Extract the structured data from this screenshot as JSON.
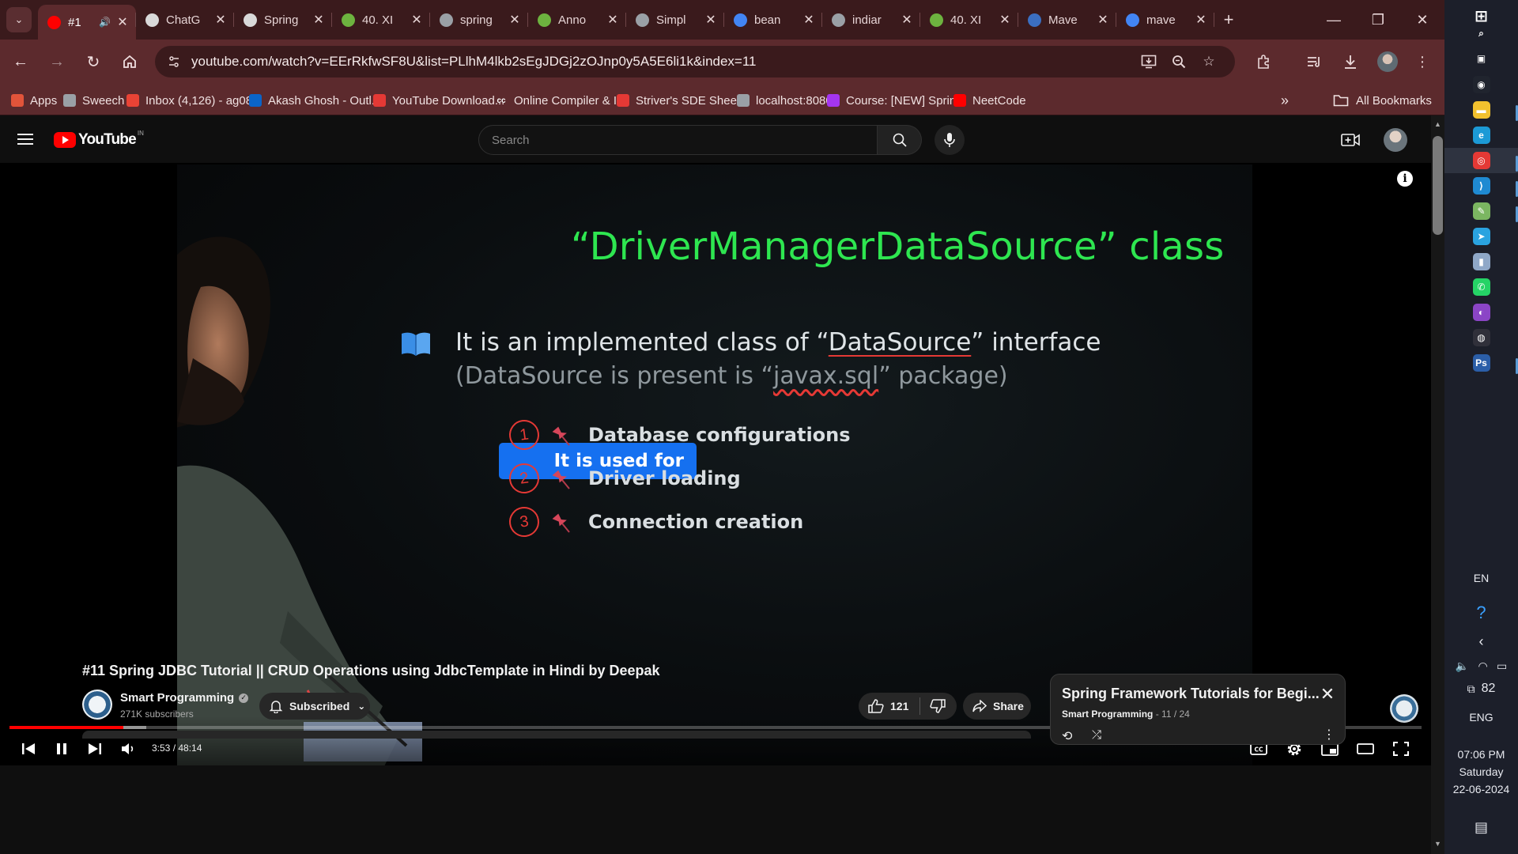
{
  "browser": {
    "tabs": [
      {
        "title": "#1",
        "fav": "youtube",
        "color": "#ff0000",
        "active": true
      },
      {
        "title": "ChatG",
        "fav": "chatgpt",
        "color": "#d9d9d9"
      },
      {
        "title": "Spring",
        "fav": "chatgpt",
        "color": "#d9d9d9"
      },
      {
        "title": "40. XI",
        "fav": "spring-leaf",
        "color": "#6db33f"
      },
      {
        "title": "spring",
        "fav": "globe",
        "color": "#9aa0a6"
      },
      {
        "title": "Anno",
        "fav": "spring-leaf",
        "color": "#6db33f"
      },
      {
        "title": "Simpl",
        "fav": "globe",
        "color": "#9aa0a6"
      },
      {
        "title": "bean",
        "fav": "google",
        "color": "#4285f4"
      },
      {
        "title": "indiar",
        "fav": "globe",
        "color": "#9aa0a6"
      },
      {
        "title": "40. XI",
        "fav": "spring-leaf",
        "color": "#6db33f"
      },
      {
        "title": "Mave",
        "fav": "maven",
        "color": "#3b6fc1"
      },
      {
        "title": "mave",
        "fav": "google",
        "color": "#4285f4"
      }
    ],
    "url": "youtube.com/watch?v=EErRkfwSF8U&list=PLlhM4lkb2sEgJDGj2zOJnp0y5A5E6li1k&index=11",
    "bookmarks": [
      {
        "label": "Apps",
        "icon": "apps-grid",
        "color": "#e2543a"
      },
      {
        "label": "Sweech",
        "icon": "globe",
        "color": "#9aa0a6"
      },
      {
        "label": "Inbox (4,126) - ag08...",
        "icon": "gmail",
        "color": "#ea4335"
      },
      {
        "label": "Akash Ghosh - Outl...",
        "icon": "outlook",
        "color": "#0a64c8"
      },
      {
        "label": "YouTube Download...",
        "icon": "download",
        "color": "#e53935"
      },
      {
        "label": "Online Compiler & I...",
        "icon": "cc",
        "color": "#ffffff"
      },
      {
        "label": "Striver's SDE Sheet...",
        "icon": "tuf",
        "color": "#e53935"
      },
      {
        "label": "localhost:8080",
        "icon": "globe",
        "color": "#9aa0a6"
      },
      {
        "label": "Course: [NEW] Sprin...",
        "icon": "udemy",
        "color": "#a435f0"
      },
      {
        "label": "NeetCode",
        "icon": "youtube",
        "color": "#ff0000"
      }
    ],
    "all_bookmarks": "All Bookmarks"
  },
  "youtube": {
    "logo_text": "YouTube",
    "country_code": "IN",
    "search_placeholder": "Search",
    "slide": {
      "title": "“DriverManagerDataSource” class",
      "line1_pre": "It is an implemented class of “",
      "line1_link": "DataSource",
      "line1_post": "” interface",
      "line2_pre": "(DataSource is present is “",
      "line2_link": "javax.sql",
      "line2_post": "” package)",
      "used_for": "It is used for",
      "items": [
        {
          "num": "1",
          "label": "Database configurations"
        },
        {
          "num": "2",
          "label": "Driver loading"
        },
        {
          "num": "3",
          "label": "Connection creation"
        }
      ]
    },
    "player": {
      "time": "3:53 / 48:14",
      "progress_fraction": 0.0806,
      "buffered_fraction": 0.097
    },
    "video_title": "#11 Spring JDBC Tutorial || CRUD Operations using JdbcTemplate in Hindi by Deepak",
    "channel": {
      "name": "Smart Programming",
      "subscribers": "271K subscribers"
    },
    "subscribe_label": "Subscribed",
    "likes": "121",
    "share_label": "Share",
    "playlist": {
      "title": "Spring Framework Tutorials for Begi...",
      "channel": "Smart Programming",
      "position": "- 11 / 24"
    }
  },
  "taskbar": {
    "apps": [
      "windows-start",
      "search",
      "task-view",
      "camera-app",
      "file-explorer",
      "edge",
      "chrome",
      "vscode",
      "notepad",
      "telegram",
      "notes",
      "whatsapp",
      "github-desktop",
      "obs",
      "photoshop"
    ],
    "lang_top": "EN",
    "battery_num": "82",
    "lang": "ENG",
    "time": "07:06 PM",
    "day": "Saturday",
    "date": "22-06-2024"
  }
}
